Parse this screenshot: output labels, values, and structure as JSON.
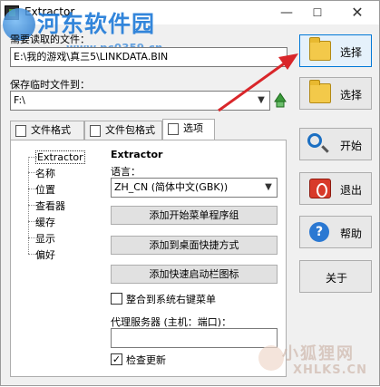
{
  "window": {
    "title": "Extractor",
    "min_glyph": "—",
    "max_glyph": "☐",
    "close_glyph": "✕"
  },
  "watermark_top": {
    "text": "河东软件园",
    "url": "www.pc0359.cn"
  },
  "watermark_bottom": {
    "text": "小狐狸网",
    "url": "XHLKS.CN"
  },
  "fields": {
    "source_label": "需要读取的文件：",
    "source_value": "E:\\我的游戏\\真三5\\LINKDATA.BIN",
    "temp_label": "保存临时文件到：",
    "temp_value": "F:\\"
  },
  "side_buttons": {
    "select1": "选择",
    "select2": "选择",
    "start": "开始",
    "exit": "退出",
    "help": "帮助",
    "about": "关于"
  },
  "tabs": [
    "文件格式",
    "文件包格式",
    "选项"
  ],
  "tree": [
    "Extractor",
    "名称",
    "位置",
    "查看器",
    "缓存",
    "显示",
    "偏好"
  ],
  "options": {
    "group_title": "Extractor",
    "language_label": "语言：",
    "language_value": "ZH_CN (简体中文(GBK))",
    "btn_start_menu": "添加开始菜单程序组",
    "btn_desktop": "添加到桌面快捷方式",
    "btn_quicklaunch": "添加快速启动栏图标",
    "chk_context": "整合到系统右键菜单",
    "proxy_label": "代理服务器 (主机：端口)：",
    "proxy_value": "",
    "chk_update": "检查更新",
    "chk_update_mark": "✓"
  },
  "colors": {
    "accent": "#0078d7",
    "arrow": "#d9262a",
    "watermark": "#1e7ad8"
  }
}
